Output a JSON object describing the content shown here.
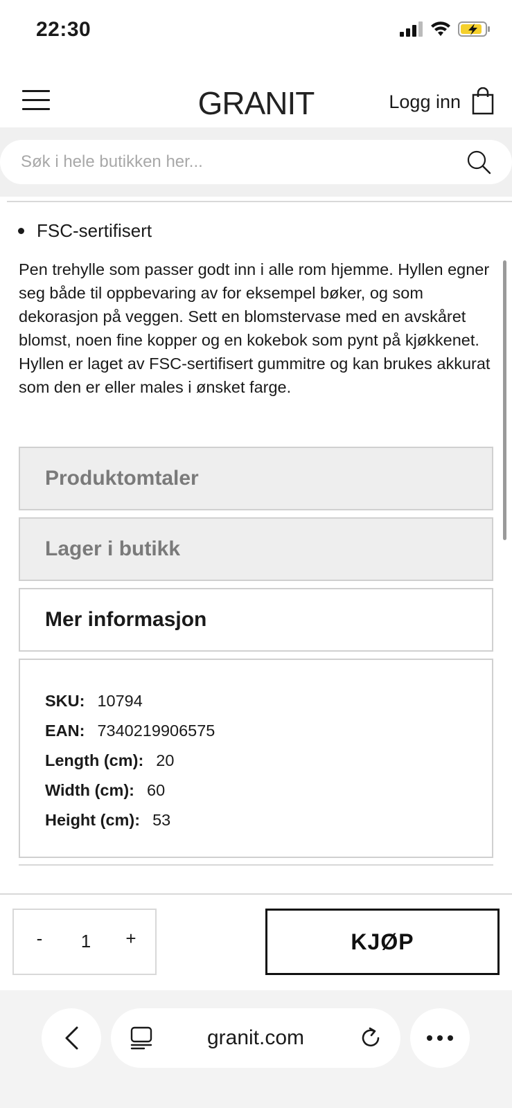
{
  "status_bar": {
    "time": "22:30",
    "icons": [
      "signal-icon",
      "wifi-icon",
      "battery-charging-icon"
    ],
    "battery_color": "#f5d02c"
  },
  "header": {
    "logo": "GRANIT",
    "login_label": "Logg inn",
    "icons": [
      "hamburger-menu-icon",
      "shopping-bag-icon"
    ]
  },
  "search": {
    "placeholder": "Søk i hele butikken her...",
    "value": "",
    "icon": "search-icon"
  },
  "product": {
    "bullet": "FSC-sertifisert",
    "description": "Pen trehylle som passer godt inn i alle rom hjemme. Hyllen egner seg både til oppbevaring av for eksempel bøker, og som dekorasjon på veggen. Sett en blomstervase med en avskåret blomst, noen fine kopper og en kokebok som pynt på kjøkkenet. Hyllen er laget av FSC-sertifisert gummitre og kan brukes akkurat som den er eller males i ønsket farge."
  },
  "accordions": [
    {
      "label": "Produktomtaler",
      "expanded": false
    },
    {
      "label": "Lager i butikk",
      "expanded": false
    },
    {
      "label": "Mer informasjon",
      "expanded": true
    }
  ],
  "more_info": [
    {
      "key": "SKU:",
      "value": "10794"
    },
    {
      "key": "EAN:",
      "value": "7340219906575"
    },
    {
      "key": "Length (cm):",
      "value": "20"
    },
    {
      "key": "Width (cm):",
      "value": "60"
    },
    {
      "key": "Height (cm):",
      "value": "53"
    }
  ],
  "buy_bar": {
    "minus_label": "-",
    "quantity": "1",
    "plus_label": "+",
    "buy_label": "KJØP"
  },
  "browser": {
    "url": "granit.com",
    "icons": [
      "back-icon",
      "reader-mode-icon",
      "reload-icon",
      "more-icon"
    ]
  }
}
